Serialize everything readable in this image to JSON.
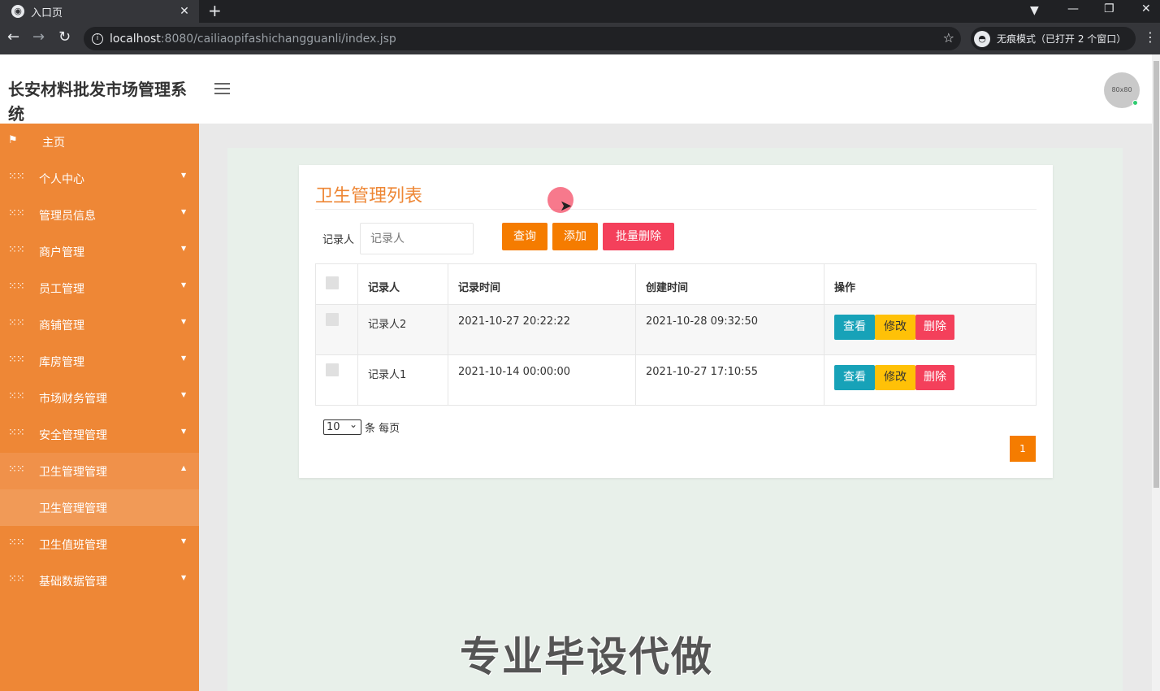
{
  "browser": {
    "tab_title": "入口页",
    "tab_close": "✕",
    "new_tab": "+",
    "url_host": "localhost",
    "url_rest": ":8080/cailiaopifashichangguanli/index.jsp",
    "incognito_label": "无痕模式（已打开 2 个窗口）",
    "icons": [
      "globe-icon",
      "close-icon",
      "plus-icon",
      "back-icon",
      "forward-icon",
      "reload-icon",
      "info-icon",
      "star-icon",
      "incognito-icon",
      "kebab-icon"
    ]
  },
  "header": {
    "title": "长安材料批发市场管理系统",
    "avatar_text": "80x80"
  },
  "sidebar": {
    "items": [
      {
        "label": "主页",
        "icon": "flag-icon"
      },
      {
        "label": "个人中心",
        "icon": "grid-icon"
      },
      {
        "label": "管理员信息",
        "icon": "grid-icon"
      },
      {
        "label": "商户管理",
        "icon": "grid-icon"
      },
      {
        "label": "员工管理",
        "icon": "grid-icon"
      },
      {
        "label": "商铺管理",
        "icon": "grid-icon"
      },
      {
        "label": "库房管理",
        "icon": "grid-icon"
      },
      {
        "label": "市场财务管理",
        "icon": "grid-icon"
      },
      {
        "label": "安全管理管理",
        "icon": "grid-icon"
      },
      {
        "label": "卫生管理管理",
        "icon": "grid-icon"
      },
      {
        "label": "卫生值班管理",
        "icon": "grid-icon"
      },
      {
        "label": "基础数据管理",
        "icon": "grid-icon"
      }
    ],
    "active_sub": "卫生管理管理"
  },
  "main": {
    "card_title": "卫生管理列表",
    "search_label": "记录人",
    "search_placeholder": "记录人",
    "buttons": {
      "query": "查询",
      "add": "添加",
      "batch_delete": "批量删除"
    },
    "table": {
      "headers": [
        "记录人",
        "记录时间",
        "创建时间",
        "操作"
      ],
      "rows": [
        {
          "recorder": "记录人2",
          "record_time": "2021-10-27 20:22:22",
          "created": "2021-10-28 09:32:50"
        },
        {
          "recorder": "记录人1",
          "record_time": "2021-10-14 00:00:00",
          "created": "2021-10-27 17:10:55"
        }
      ],
      "actions": {
        "view": "查看",
        "edit": "修改",
        "delete": "删除"
      }
    },
    "page_size": "10",
    "page_size_suffix": "条 每页",
    "current_page": "1"
  },
  "watermark": "专业毕设代做",
  "colors": {
    "accent": "#ee8736",
    "orange_btn": "#f57c00",
    "danger": "#f4405b",
    "info": "#17a2b8",
    "warning": "#ffc107"
  }
}
